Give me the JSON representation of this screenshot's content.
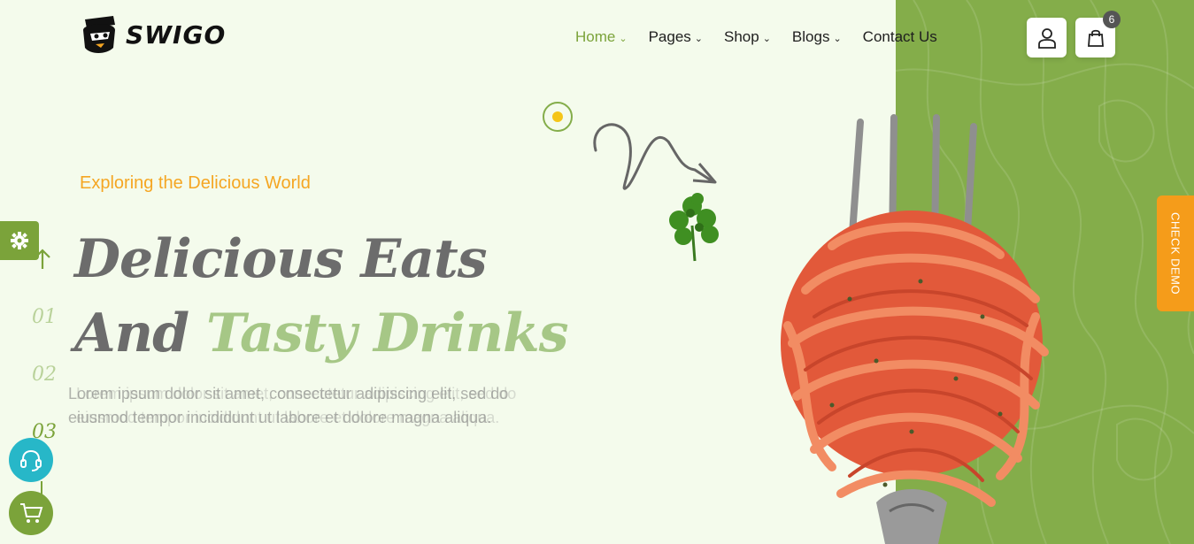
{
  "brand": {
    "name": "SWIGO"
  },
  "nav": {
    "items": [
      {
        "label": "Home",
        "has_dropdown": true,
        "active": true
      },
      {
        "label": "Pages",
        "has_dropdown": true,
        "active": false
      },
      {
        "label": "Shop",
        "has_dropdown": true,
        "active": false
      },
      {
        "label": "Blogs",
        "has_dropdown": true,
        "active": false
      },
      {
        "label": "Contact Us",
        "has_dropdown": false,
        "active": false
      }
    ]
  },
  "header": {
    "user_icon": "user-icon",
    "cart_icon": "shopping-bag-icon",
    "cart_count": "6"
  },
  "hero": {
    "tagline": "Exploring the Delicious World",
    "headline_line1": "Delicious Eats",
    "headline_line2_dark": "And ",
    "headline_line2_light": "Tasty Drinks",
    "description": "Lorem ipsum dolor sit amet, consectetur adipiscing elit, sed do eiusmod tempor incididunt ut labore et dolore magna aliqua."
  },
  "slider": {
    "numbers": [
      "01",
      "02",
      "03"
    ],
    "active_index": 2
  },
  "widgets": {
    "check_demo": "CHECK DEMO"
  },
  "colors": {
    "accent_green": "#84ad4a",
    "accent_orange": "#f5a623",
    "background": "#f4fbec",
    "support_teal": "#27b7c8"
  }
}
